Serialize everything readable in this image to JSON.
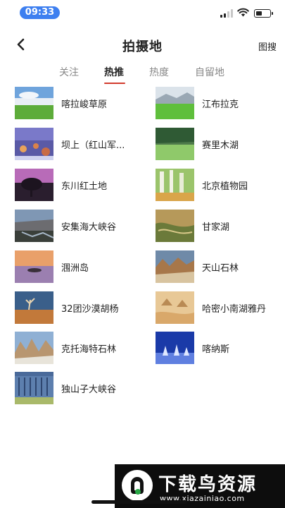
{
  "status_bar": {
    "time": "09:33"
  },
  "header": {
    "title": "拍摄地",
    "search_label": "图搜"
  },
  "tabs": [
    {
      "label": "关注",
      "active": false
    },
    {
      "label": "热推",
      "active": true
    },
    {
      "label": "热度",
      "active": false
    },
    {
      "label": "自留地",
      "active": false
    }
  ],
  "places": [
    {
      "name": "喀拉峻草原"
    },
    {
      "name": "江布拉克"
    },
    {
      "name": "坝上（红山军..."
    },
    {
      "name": "赛里木湖"
    },
    {
      "name": "东川红土地"
    },
    {
      "name": "北京植物园"
    },
    {
      "name": "安集海大峡谷"
    },
    {
      "name": "甘家湖"
    },
    {
      "name": "涠洲岛"
    },
    {
      "name": "天山石林"
    },
    {
      "name": "32团沙漠胡杨"
    },
    {
      "name": "哈密小南湖雅丹"
    },
    {
      "name": "克托海特石林"
    },
    {
      "name": "喀纳斯"
    },
    {
      "name": "独山子大峡谷"
    }
  ],
  "watermark": {
    "title": "下载鸟资源",
    "url": "www.xiazainiao.com"
  },
  "colors": {
    "accent": "#d23b2e",
    "time_pill": "#3d7ff0"
  }
}
